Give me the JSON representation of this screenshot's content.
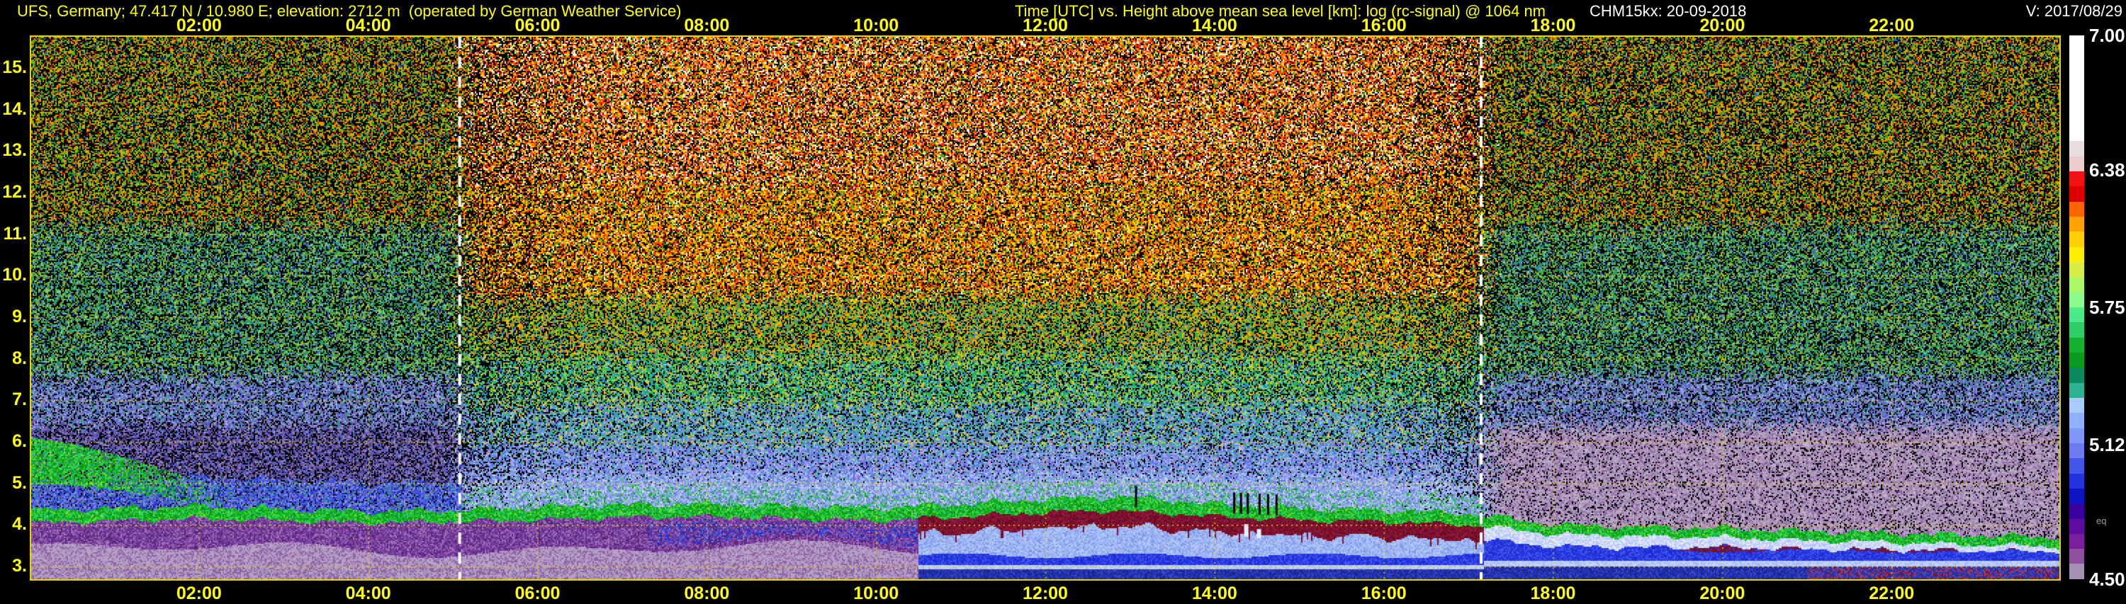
{
  "header": {
    "station": "UFS, Germany; 47.417 N / 10.980 E; elevation: 2712 m  (operated by German Weather Service)",
    "title": "Time [UTC] vs. Height above mean sea level [km]: log (rc-signal) @ 1064 nm",
    "instrument": "CHM15kx: 20-09-2018",
    "version": "V: 2017/08/29"
  },
  "axes": {
    "x_tick_labels": [
      "02:00",
      "04:00",
      "06:00",
      "08:00",
      "10:00",
      "12:00",
      "14:00",
      "16:00",
      "18:00",
      "20:00",
      "22:00"
    ],
    "x_tick_hours": [
      2,
      4,
      6,
      8,
      10,
      12,
      14,
      16,
      18,
      20,
      22
    ],
    "y_tick_labels": [
      "15.",
      "14.",
      "13.",
      "12.",
      "11.",
      "10.",
      "9.",
      "8.",
      "7.",
      "6.",
      "5.",
      "4.",
      "3."
    ],
    "y_tick_values": [
      15,
      14,
      13,
      12,
      11,
      10,
      9,
      8,
      7,
      6,
      5,
      4,
      3
    ]
  },
  "colorbar": {
    "tick_labels": [
      "7.00",
      "6.38",
      "5.75",
      "5.12",
      "4.50"
    ],
    "tick_values": [
      7.0,
      6.38,
      5.75,
      5.12,
      4.5
    ],
    "annotation": "eq",
    "colors": [
      "#ffffff",
      "#ffffff",
      "#ffffff",
      "#ffffff",
      "#ffffff",
      "#ffffff",
      "#ffffff",
      "#e9dede",
      "#edcccc",
      "#f31111",
      "#de0000",
      "#ff6600",
      "#ffa300",
      "#ffd000",
      "#ffee00",
      "#d9ee44",
      "#aaf866",
      "#8dfa8d",
      "#4dea8b",
      "#2fcd67",
      "#15b030",
      "#0b9a1e",
      "#0b8a60",
      "#2cb492",
      "#a9ccff",
      "#90b1ff",
      "#7e97f8",
      "#6a7cf0",
      "#4356e8",
      "#2334de",
      "#0d14c4",
      "#3a00a0",
      "#5c0d9e",
      "#7a1f9e",
      "#8d4f9e",
      "#a391b4"
    ]
  },
  "colors": {
    "background": "#000000",
    "axis_text": "#ffff00",
    "right_text": "#ffffff",
    "border": "#e3d400",
    "grid": "#e8cc00",
    "sun_line": "#ffffff"
  },
  "chart_data": {
    "type": "heatmap",
    "x_label": "Time [UTC]",
    "y_label": "Height above mean sea level [km]",
    "quantity": "log (rc-signal) @ 1064 nm",
    "x_range_hours": [
      0,
      24
    ],
    "y_axis_km": [
      3,
      15
    ],
    "colorbar_range": [
      4.5,
      7.0
    ],
    "grid_x_step_hours": 2,
    "grid_y_step_km": 1,
    "sun_lines_hours": [
      5.08,
      17.15
    ],
    "aerosol_layer": {
      "times": [
        0,
        1,
        2,
        3,
        4,
        5,
        6,
        7,
        8,
        9,
        10,
        11,
        12,
        12.8,
        13.5,
        14,
        15,
        16,
        17,
        17.5,
        18,
        19,
        20,
        21,
        22,
        23,
        24
      ],
      "top_km": [
        4.35,
        4.4,
        4.45,
        4.38,
        4.32,
        4.35,
        4.42,
        4.48,
        4.5,
        4.45,
        4.4,
        4.5,
        4.62,
        4.68,
        4.6,
        4.5,
        4.4,
        4.35,
        4.28,
        4.15,
        4.0,
        3.95,
        3.92,
        3.85,
        3.8,
        3.75,
        3.7
      ],
      "bottom_km": [
        4.05,
        4.1,
        4.15,
        4.1,
        4.05,
        4.08,
        4.12,
        4.18,
        4.2,
        4.15,
        4.1,
        4.2,
        4.3,
        4.35,
        4.28,
        4.2,
        4.12,
        4.08,
        4.0,
        3.9,
        3.78,
        3.72,
        3.7,
        3.62,
        3.58,
        3.52,
        3.48
      ]
    },
    "morning_blob": {
      "times": [
        0,
        0.5,
        1,
        1.5,
        2,
        2.5
      ],
      "top_km": [
        6.1,
        5.95,
        5.7,
        5.4,
        5.05,
        4.75
      ],
      "bottom_km": [
        5.0,
        4.95,
        4.85,
        4.68,
        4.5,
        4.42
      ],
      "weight": [
        1,
        1,
        0.85,
        0.55,
        0.25,
        0
      ]
    },
    "artifacts": {
      "black_ticks_hours": [
        13.06,
        14.22,
        14.3,
        14.38,
        14.52,
        14.62,
        14.72
      ],
      "white_patches": [
        [
          14.35,
          3.72,
          0.3
        ],
        [
          14.5,
          3.68,
          0.22
        ]
      ]
    },
    "palettes": {
      "green": [
        [
          "#17b023",
          0.4
        ],
        [
          "#2ed446",
          0.25
        ],
        [
          "#0c8f17",
          0.2
        ],
        [
          "#7fdc3c",
          0.08
        ],
        [
          "#20c890",
          0.07
        ]
      ],
      "morningBlue": [
        [
          "#4b5fd8",
          0.3
        ],
        [
          "#2a3ce0",
          0.2
        ],
        [
          "#6f80e8",
          0.2
        ],
        [
          "#141a80",
          0.12
        ],
        [
          "#8a98ec",
          0.1
        ],
        [
          "#20a070",
          0.08
        ]
      ],
      "purple": [
        [
          "#7a3f9f",
          0.26
        ],
        [
          "#68308c",
          0.22
        ],
        [
          "#8f55ab",
          0.2
        ],
        [
          "#512577",
          0.16
        ],
        [
          "#a272bc",
          0.16
        ]
      ],
      "blueDark": [
        [
          "#2a3ce0",
          0.4
        ],
        [
          "#1c2cb0",
          0.3
        ],
        [
          "#4b5fd8",
          0.3
        ]
      ],
      "wisp": [
        [
          "#b8a2c6",
          0.4
        ],
        [
          "#a98fbc",
          0.3
        ],
        [
          "#8f64a8",
          0.3
        ]
      ],
      "bottomA": [
        [
          "#a78fb8",
          0.45
        ],
        [
          "#8d63a3",
          0.35
        ],
        [
          "#b9aac6",
          0.2
        ]
      ],
      "maroon": [
        [
          "#7c1030",
          0.5
        ],
        [
          "#8f1b3c",
          0.3
        ],
        [
          "#64081f",
          0.2
        ]
      ],
      "maroon2": [
        [
          "#6e1030",
          0.5
        ],
        [
          "#7e1838",
          0.3
        ],
        [
          "#2a3ce4",
          0.2
        ]
      ],
      "lightBlue": [
        [
          "#9ab2f2",
          0.5
        ],
        [
          "#b4c6f6",
          0.3
        ],
        [
          "#8198ea",
          0.2
        ]
      ],
      "blueBright": [
        [
          "#2a3ce4",
          0.45
        ],
        [
          "#1b2bd0",
          0.3
        ],
        [
          "#4356ea",
          0.25
        ]
      ],
      "pale": [
        [
          "#c2d2f8",
          0.6
        ],
        [
          "#a8bcf4",
          0.4
        ]
      ],
      "blueDeep": [
        [
          "#2433b0",
          0.5
        ],
        [
          "#1a2690",
          0.3
        ],
        [
          "#3847cc",
          0.2
        ]
      ],
      "blueDeepRed": [
        [
          "#2433b0",
          0.4
        ],
        [
          "#a03a58",
          0.25
        ],
        [
          "#3847cc",
          0.2
        ],
        [
          "#7c1030",
          0.15
        ]
      ],
      "lavWhite": [
        [
          "#cdd8fb",
          0.45
        ],
        [
          "#b6c4f6",
          0.3
        ],
        [
          "#e6ecfd",
          0.25
        ]
      ],
      "dayTop": [
        [
          "#ff2800",
          0.16
        ],
        [
          "#ff7000",
          0.15
        ],
        [
          "#ffd800",
          0.13
        ],
        [
          "#ffffff",
          0.13
        ],
        [
          "#2f9e20",
          0.07
        ],
        [
          "#000000",
          0.3
        ],
        [
          "#ff9a60",
          0.06
        ]
      ],
      "dayHigh": [
        [
          "#ff5500",
          0.17
        ],
        [
          "#ffaa00",
          0.16
        ],
        [
          "#ffe000",
          0.13
        ],
        [
          "#c42000",
          0.1
        ],
        [
          "#3aa426",
          0.11
        ],
        [
          "#000000",
          0.27
        ],
        [
          "#ffffff",
          0.06
        ]
      ],
      "dayOlive": [
        [
          "#ffb400",
          0.13
        ],
        [
          "#c8cc00",
          0.1
        ],
        [
          "#4aa828",
          0.2
        ],
        [
          "#ff6a00",
          0.08
        ],
        [
          "#000000",
          0.29
        ],
        [
          "#22b868",
          0.1
        ],
        [
          "#4b82cc",
          0.1
        ]
      ],
      "dayGreen": [
        [
          "#2fae4a",
          0.22
        ],
        [
          "#19c87d",
          0.13
        ],
        [
          "#a8cc30",
          0.1
        ],
        [
          "#000000",
          0.25
        ],
        [
          "#3a6ee0",
          0.12
        ],
        [
          "#7fc8ea",
          0.08
        ],
        [
          "#ffc800",
          0.1
        ]
      ],
      "dayTeal": [
        [
          "#28b87a",
          0.17
        ],
        [
          "#3f8fd0",
          0.17
        ],
        [
          "#6f86e8",
          0.16
        ],
        [
          "#000000",
          0.2
        ],
        [
          "#96dcbe",
          0.1
        ],
        [
          "#ffd000",
          0.06
        ],
        [
          "#8f8fe0",
          0.14
        ]
      ],
      "dayBlue": [
        [
          "#6f86e8",
          0.22
        ],
        [
          "#8fa6f0",
          0.2
        ],
        [
          "#4f66d8",
          0.16
        ],
        [
          "#000000",
          0.12
        ],
        [
          "#48b890",
          0.1
        ],
        [
          "#b6c2f4",
          0.12
        ],
        [
          "#c088c8",
          0.08
        ]
      ],
      "dayPale": [
        [
          "#96aaf0",
          0.28
        ],
        [
          "#b0c0f4",
          0.22
        ],
        [
          "#7f90e8",
          0.2
        ],
        [
          "#6878d8",
          0.12
        ],
        [
          "#58c098",
          0.08
        ],
        [
          "#d0d8f8",
          0.1
        ]
      ],
      "nightTop": [
        [
          "#c8b400",
          0.13
        ],
        [
          "#ff8800",
          0.1
        ],
        [
          "#c42000",
          0.08
        ],
        [
          "#2f9e20",
          0.16
        ],
        [
          "#1b62c4",
          0.05
        ],
        [
          "#000000",
          0.42
        ],
        [
          "#74c240",
          0.06
        ]
      ],
      "nightMid": [
        [
          "#2f9e3a",
          0.18
        ],
        [
          "#22a584",
          0.12
        ],
        [
          "#aab400",
          0.1
        ],
        [
          "#000000",
          0.38
        ],
        [
          "#4663c6",
          0.12
        ],
        [
          "#84cc96",
          0.1
        ]
      ],
      "nightBlue": [
        [
          "#5464cc",
          0.22
        ],
        [
          "#8492da",
          0.18
        ],
        [
          "#000000",
          0.26
        ],
        [
          "#2fa080",
          0.1
        ],
        [
          "#7464ac",
          0.14
        ],
        [
          "#aab2e4",
          0.1
        ]
      ],
      "nightMauve": [
        [
          "#b69ec0",
          0.36
        ],
        [
          "#9c86b0",
          0.22
        ],
        [
          "#000000",
          0.14
        ],
        [
          "#88639e",
          0.18
        ],
        [
          "#c6b6cc",
          0.1
        ]
      ],
      "nightLowLeft": [
        [
          "#6a52a4",
          0.2
        ],
        [
          "#5464cc",
          0.18
        ],
        [
          "#000000",
          0.3
        ],
        [
          "#9c86b0",
          0.16
        ],
        [
          "#3c3278",
          0.16
        ]
      ]
    }
  }
}
